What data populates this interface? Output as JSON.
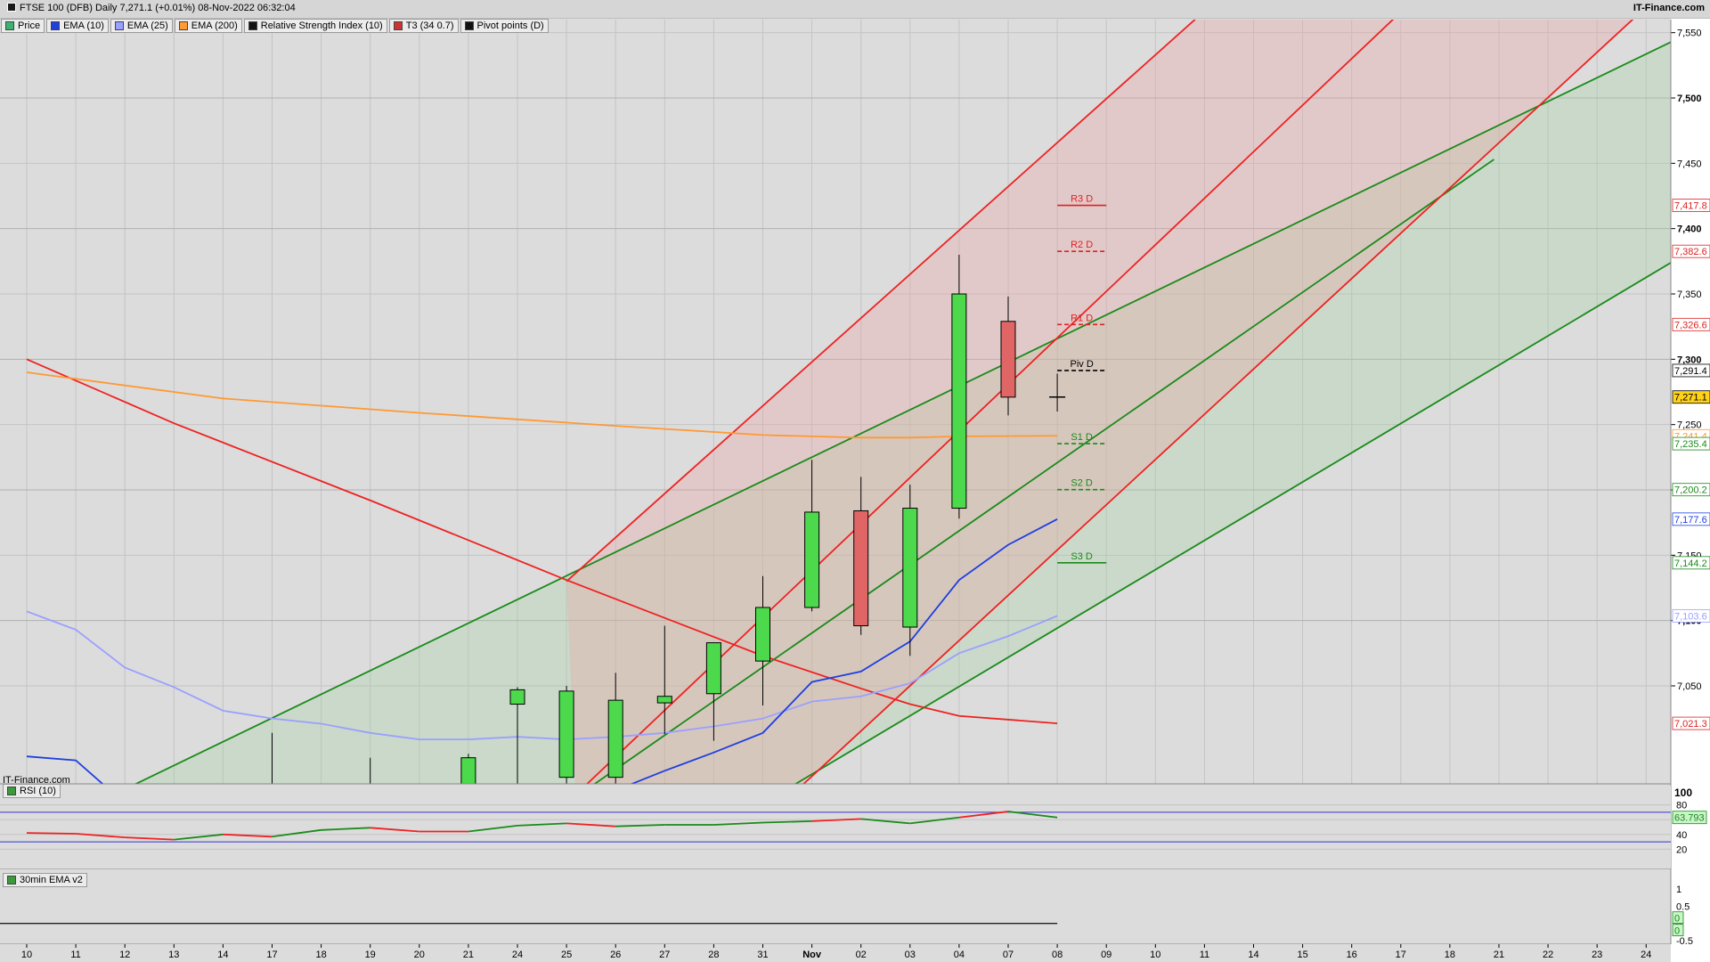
{
  "header": {
    "title": "FTSE 100 (DFB) Daily 7,271.1 (+0.01%) 08-Nov-2022 06:32:04",
    "brand": "IT-Finance.com",
    "watermark": "IT-Finance.com"
  },
  "legend": [
    {
      "label": "Price",
      "color": "#3cb371"
    },
    {
      "label": "EMA (10)",
      "color": "#1f3fe0"
    },
    {
      "label": "EMA (25)",
      "color": "#9aa0ff"
    },
    {
      "label": "EMA (200)",
      "color": "#ff9933"
    },
    {
      "label": "Relative Strength Index (10)",
      "color": "#111111"
    },
    {
      "label": "T3 (34 0.7)",
      "color": "#cc3333"
    },
    {
      "label": "Pivot points (D)",
      "color": "#111111"
    }
  ],
  "panels": {
    "rsi_label": "RSI (10)",
    "ema30_label": "30min EMA v2"
  },
  "colors": {
    "background": "#dcdcdc",
    "bull": "#4cd94c",
    "bear": "#e06666",
    "ema10": "#1f3fe0",
    "ema25": "#9aa0ff",
    "ema200": "#ff9933",
    "channel_red": "#ee2222",
    "channel_green": "#1a8a1a",
    "grid": "#c4c4c4"
  },
  "chart_data": {
    "type": "candlestick",
    "x_labels": [
      "10",
      "11",
      "12",
      "13",
      "14",
      "17",
      "18",
      "19",
      "20",
      "21",
      "24",
      "25",
      "26",
      "27",
      "28",
      "31",
      "Nov",
      "02",
      "03",
      "04",
      "07",
      "08",
      "09",
      "10",
      "11",
      "14",
      "15",
      "16",
      "17",
      "18",
      "21",
      "22",
      "23",
      "24"
    ],
    "ylim": [
      6975,
      7560
    ],
    "y_ticks": [
      7050,
      7100,
      7150,
      7200,
      7250,
      7300,
      7350,
      7400,
      7450,
      7500,
      7550
    ],
    "y_tick_labels": [
      "7,050",
      "7,100",
      "7,150",
      "7,200",
      "7,250",
      "7,300",
      "7,350",
      "7,400",
      "7,450",
      "7,500",
      "7,550"
    ],
    "candles": [
      {
        "x": 5,
        "o": null,
        "h": 7014,
        "l": 6960,
        "c": null
      },
      {
        "x": 7,
        "o": null,
        "h": 6995,
        "l": 6960,
        "c": null
      },
      {
        "x": 9,
        "o": 6970,
        "h": 6998,
        "l": 6960,
        "c": 6995
      },
      {
        "x": 10,
        "o": 7036,
        "h": 7049,
        "l": 6960,
        "c": 7047
      },
      {
        "x": 11,
        "o": 6980,
        "h": 7050,
        "l": 6960,
        "c": 7046
      },
      {
        "x": 12,
        "o": 6980,
        "h": 7060,
        "l": 6960,
        "c": 7039
      },
      {
        "x": 13,
        "o": 7037,
        "h": 7096,
        "l": 7013,
        "c": 7042
      },
      {
        "x": 14,
        "o": 7044,
        "h": 7083,
        "l": 7008,
        "c": 7083
      },
      {
        "x": 15,
        "o": 7069,
        "h": 7134,
        "l": 7035,
        "c": 7110
      },
      {
        "x": 16,
        "o": 7110,
        "h": 7223,
        "l": 7107,
        "c": 7183
      },
      {
        "x": 17,
        "o": 7184,
        "h": 7210,
        "l": 7089,
        "c": 7096
      },
      {
        "x": 18,
        "o": 7095,
        "h": 7204,
        "l": 7073,
        "c": 7186
      },
      {
        "x": 19,
        "o": 7186,
        "h": 7380,
        "l": 7178,
        "c": 7350
      },
      {
        "x": 20,
        "o": 7329,
        "h": 7348,
        "l": 7257,
        "c": 7271
      },
      {
        "x": 21,
        "o": 7271,
        "h": 7289,
        "l": 7260,
        "c": 7271.1
      }
    ],
    "ema10": {
      "x": [
        0,
        1,
        2,
        3,
        4,
        5,
        6,
        7,
        8,
        9,
        10,
        11,
        12,
        13,
        14,
        15,
        16,
        17,
        18,
        19,
        20,
        21
      ],
      "y": [
        6996,
        6993,
        6960,
        6950,
        6945,
        6940,
        6935,
        6930,
        6925,
        6925,
        6930,
        6960,
        6970,
        6985,
        6999,
        7014,
        7053,
        7061,
        7084,
        7131,
        7158,
        7177.6
      ]
    },
    "ema25": {
      "x": [
        0,
        1,
        2,
        3,
        4,
        5,
        6,
        7,
        8,
        9,
        10,
        11,
        12,
        13,
        14,
        15,
        16,
        17,
        18,
        19,
        20,
        21
      ],
      "y": [
        7107,
        7093,
        7064,
        7049,
        7031,
        7025,
        7021,
        7014,
        7009,
        7009,
        7011,
        7009,
        7011,
        7014,
        7019,
        7025,
        7038,
        7042,
        7052,
        7075,
        7088,
        7103.6
      ]
    },
    "ema200": {
      "x": [
        0,
        4,
        8,
        12,
        15,
        17,
        18,
        19,
        21
      ],
      "y": [
        7290,
        7270,
        7259,
        7249,
        7242,
        7240,
        7240,
        7241,
        7241.4
      ]
    },
    "t3": {
      "x": [
        0,
        3,
        7,
        11,
        15,
        17,
        18,
        19,
        21
      ],
      "y": [
        7300,
        7251,
        7192,
        7131,
        7073,
        7048,
        7036,
        7027,
        7021.3
      ]
    },
    "pivots": [
      {
        "label": "R3 D",
        "value": 7417.8,
        "kind": "red"
      },
      {
        "label": "R2 D",
        "value": 7382.6,
        "kind": "red-dash"
      },
      {
        "label": "R1 D",
        "value": 7326.6,
        "kind": "red-dash"
      },
      {
        "label": "Piv D",
        "value": 7291.4,
        "kind": "black-dash"
      },
      {
        "label": "S1 D",
        "value": 7235.4,
        "kind": "green-dash"
      },
      {
        "label": "S2 D",
        "value": 7200.2,
        "kind": "green-dash"
      },
      {
        "label": "S3 D",
        "value": 7144.2,
        "kind": "green"
      }
    ],
    "price_tags": [
      {
        "value": 7417.8,
        "text": "7,417.8",
        "color": "#dd2222",
        "bg": "#ffffff"
      },
      {
        "value": 7382.6,
        "text": "7,382.6",
        "color": "#dd2222",
        "bg": "#ffffff"
      },
      {
        "value": 7326.6,
        "text": "7,326.6",
        "color": "#dd2222",
        "bg": "#ffffff"
      },
      {
        "value": 7291.4,
        "text": "7,291.4",
        "color": "#000000",
        "bg": "#ffffff"
      },
      {
        "value": 7271.1,
        "text": "7,271.1",
        "color": "#000000",
        "bg": "#ffd21a"
      },
      {
        "value": 7241.4,
        "text": "7,241.4",
        "color": "#ff9933",
        "bg": "#ffffff"
      },
      {
        "value": 7235.4,
        "text": "7,235.4",
        "color": "#1a8a1a",
        "bg": "#ffffff"
      },
      {
        "value": 7200.2,
        "text": "7,200.2",
        "color": "#1a8a1a",
        "bg": "#ffffff"
      },
      {
        "value": 7177.6,
        "text": "7,177.6",
        "color": "#1f3fe0",
        "bg": "#ffffff"
      },
      {
        "value": 7144.2,
        "text": "7,144.2",
        "color": "#1a8a1a",
        "bg": "#ffffff"
      },
      {
        "value": 7103.6,
        "text": "7,103.6",
        "color": "#9aa0ff",
        "bg": "#ffffff"
      },
      {
        "value": 7021.3,
        "text": "7,021.3",
        "color": "#dd2222",
        "bg": "#ffffff"
      }
    ],
    "channels": {
      "green": [
        {
          "x1": 1.4,
          "y1": 6960,
          "x2": 33.9,
          "y2": 7550
        },
        {
          "x1": 15.0,
          "y1": 6960,
          "x2": 34.0,
          "y2": 7385
        },
        {
          "x1": 11.0,
          "y1": 6960,
          "x2": 29.9,
          "y2": 7453
        }
      ],
      "red": [
        {
          "x1": 11.0,
          "y1": 7130,
          "x2": 24.4,
          "y2": 7580
        },
        {
          "x1": 15.4,
          "y1": 6960,
          "x2": 33.3,
          "y2": 7580
        },
        {
          "x1": 11.0,
          "y1": 6960,
          "x2": 28.4,
          "y2": 7580
        }
      ]
    },
    "rsi": {
      "ylim": [
        0,
        100
      ],
      "ticks": [
        20,
        40,
        60,
        80
      ],
      "tick_labels": [
        "20",
        "40",
        "60",
        "80"
      ],
      "top_label": "100",
      "band": [
        30,
        70
      ],
      "last_text": "63.793",
      "x": [
        0,
        1,
        2,
        3,
        4,
        5,
        6,
        7,
        8,
        9,
        10,
        11,
        12,
        13,
        14,
        15,
        16,
        17,
        18,
        19,
        20,
        21
      ],
      "y": [
        42,
        41,
        36,
        33,
        40,
        37,
        46,
        49,
        44,
        44,
        52,
        55,
        51,
        53,
        53,
        56,
        58,
        61,
        55,
        63,
        71,
        63
      ],
      "segments": [
        "#ee2222",
        "#ee2222",
        "#ee2222",
        "#1a8a1a",
        "#ee2222",
        "#1a8a1a",
        "#1a8a1a",
        "#ee2222",
        "#ee2222",
        "#1a8a1a",
        "#1a8a1a",
        "#ee2222",
        "#1a8a1a",
        "#1a8a1a",
        "#1a8a1a",
        "#1a8a1a",
        "#ee2222",
        "#1a8a1a",
        "#1a8a1a",
        "#ee2222",
        "#1a8a1a"
      ]
    },
    "ema30": {
      "tick_labels": [
        "1",
        "0.5",
        "0",
        "-0.5"
      ],
      "tick_values": [
        1,
        0.5,
        0,
        -0.5
      ],
      "tags": [
        "0",
        "0"
      ]
    }
  }
}
